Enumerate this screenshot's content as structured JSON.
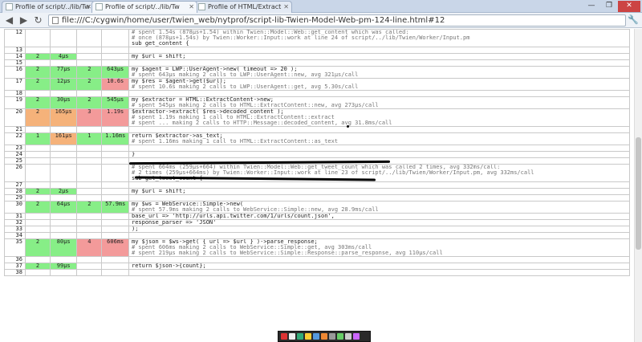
{
  "browser": {
    "tabs": [
      {
        "title": "Profile of script/../lib/Tw"
      },
      {
        "title": "Profile of script/../lib/Tw"
      },
      {
        "title": "Profile of HTML/Extract"
      }
    ],
    "address": "file:///C:/cygwin/home/user/twien_web/nytprof/script-lib-Twien-Model-Web-pm-124-line.html#12"
  },
  "rows": [
    {
      "ln": "12",
      "c1": "",
      "c2": "",
      "c3": "",
      "c4": "",
      "cls": [
        "",
        "",
        "",
        ""
      ],
      "code": [
        "# spent 1.54s (878µs+1.54) within Twien::Model::Web::get_content which was called:",
        "#   once (878µs+1.54s) by Twien::Worker::Input::work at line 24 of script/../lib/Twien/Worker/Input.pm",
        "sub get_content {"
      ]
    },
    {
      "ln": "13",
      "c1": "",
      "c2": "",
      "c3": "",
      "c4": "",
      "cls": [
        "",
        "",
        "",
        ""
      ],
      "code": [
        ""
      ]
    },
    {
      "ln": "14",
      "c1": "2",
      "c2": "4µs",
      "c3": "",
      "c4": "",
      "cls": [
        "g",
        "g",
        "",
        ""
      ],
      "code": [
        "    my $url = shift;"
      ]
    },
    {
      "ln": "15",
      "c1": "",
      "c2": "",
      "c3": "",
      "c4": "",
      "cls": [
        "",
        "",
        "",
        ""
      ],
      "code": [
        ""
      ]
    },
    {
      "ln": "16",
      "c1": "2",
      "c2": "77µs",
      "c3": "2",
      "c4": "643µs",
      "cls": [
        "g",
        "g",
        "g",
        "g"
      ],
      "code": [
        "    my $agent = LWP::UserAgent->new( timeout => 20 );",
        "    # spent   643µs making 2 calls to LWP::UserAgent::new, avg 321µs/call"
      ]
    },
    {
      "ln": "17",
      "c1": "2",
      "c2": "12µs",
      "c3": "2",
      "c4": "10.6s",
      "cls": [
        "g",
        "g",
        "g",
        "r"
      ],
      "code": [
        "    my $res = $agent->get($url);",
        "    # spent  10.6s making 2 calls to LWP::UserAgent::get, avg 5.30s/call"
      ]
    },
    {
      "ln": "18",
      "c1": "",
      "c2": "",
      "c3": "",
      "c4": "",
      "cls": [
        "",
        "",
        "",
        ""
      ],
      "code": [
        ""
      ]
    },
    {
      "ln": "19",
      "c1": "2",
      "c2": "30µs",
      "c3": "2",
      "c4": "545µs",
      "cls": [
        "g",
        "g",
        "g",
        "g"
      ],
      "code": [
        "    my $extractor = HTML::ExtractContent->new;",
        "    # spent   545µs making 2 calls to HTML::ExtractContent::new, avg 273µs/call"
      ]
    },
    {
      "ln": "20",
      "c1": "2",
      "c2": "165µs",
      "c3": "3",
      "c4": "1.19s",
      "cls": [
        "o",
        "o",
        "r",
        "r"
      ],
      "code": [
        "    $extractor->extract( $res->decoded_content );",
        "    # spent  1.19s making 1 call to HTML::ExtractContent::extract",
        "    # spent  ...  making 2 calls to HTTP::Message::decoded_content, avg 31.8ms/call"
      ]
    },
    {
      "ln": "21",
      "c1": "",
      "c2": "",
      "c3": "",
      "c4": "",
      "cls": [
        "",
        "",
        "",
        ""
      ],
      "code": [
        ""
      ]
    },
    {
      "ln": "22",
      "c1": "1",
      "c2": "161µs",
      "c3": "1",
      "c4": "1.16ms",
      "cls": [
        "g",
        "o",
        "g",
        "g"
      ],
      "code": [
        "    return $extractor->as_text;",
        "    # spent  1.16ms making 1 call to HTML::ExtractContent::as_text"
      ]
    },
    {
      "ln": "23",
      "c1": "",
      "c2": "",
      "c3": "",
      "c4": "",
      "cls": [
        "",
        "",
        "",
        ""
      ],
      "code": [
        ""
      ]
    },
    {
      "ln": "24",
      "c1": "",
      "c2": "",
      "c3": "",
      "c4": "",
      "cls": [
        "",
        "",
        "",
        ""
      ],
      "code": [
        "}"
      ]
    },
    {
      "ln": "25",
      "c1": "",
      "c2": "",
      "c3": "",
      "c4": "",
      "cls": [
        "",
        "",
        "",
        ""
      ],
      "code": [
        ""
      ]
    },
    {
      "ln": "26",
      "c1": "",
      "c2": "",
      "c3": "",
      "c4": "",
      "cls": [
        "",
        "",
        "",
        ""
      ],
      "code": [
        "# spent 664ms (259µs+664) within Twien::Model::Web::get_tweet_count which was called 2 times, avg 332ms/call:",
        "# 2 times (259µs+664ms) by Twien::Worker::Input::work at line 23 of script/../lib/Twien/Worker/Input.pm, avg 332ms/call",
        "sub get_tweet_count {"
      ]
    },
    {
      "ln": "27",
      "c1": "",
      "c2": "",
      "c3": "",
      "c4": "",
      "cls": [
        "",
        "",
        "",
        ""
      ],
      "code": [
        ""
      ]
    },
    {
      "ln": "28",
      "c1": "2",
      "c2": "2µs",
      "c3": "",
      "c4": "",
      "cls": [
        "g",
        "g",
        "",
        ""
      ],
      "code": [
        "    my $url = shift;"
      ]
    },
    {
      "ln": "29",
      "c1": "",
      "c2": "",
      "c3": "",
      "c4": "",
      "cls": [
        "",
        "",
        "",
        ""
      ],
      "code": [
        ""
      ]
    },
    {
      "ln": "30",
      "c1": "2",
      "c2": "64µs",
      "c3": "2",
      "c4": "57.9ms",
      "cls": [
        "g",
        "g",
        "g",
        "g"
      ],
      "code": [
        "    my $ws = WebService::Simple->new(",
        "    # spent  57.9ms making 2 calls to WebService::Simple::new, avg 28.9ms/call"
      ]
    },
    {
      "ln": "31",
      "c1": "",
      "c2": "",
      "c3": "",
      "c4": "",
      "cls": [
        "",
        "",
        "",
        ""
      ],
      "code": [
        "        base_url        => 'http://urls.api.twitter.com/1/urls/count.json',"
      ]
    },
    {
      "ln": "32",
      "c1": "",
      "c2": "",
      "c3": "",
      "c4": "",
      "cls": [
        "",
        "",
        "",
        ""
      ],
      "code": [
        "        response_parser => 'JSON'"
      ]
    },
    {
      "ln": "33",
      "c1": "",
      "c2": "",
      "c3": "",
      "c4": "",
      "cls": [
        "",
        "",
        "",
        ""
      ],
      "code": [
        "    );"
      ]
    },
    {
      "ln": "34",
      "c1": "",
      "c2": "",
      "c3": "",
      "c4": "",
      "cls": [
        "",
        "",
        "",
        ""
      ],
      "code": [
        ""
      ]
    },
    {
      "ln": "35",
      "c1": "2",
      "c2": "80µs",
      "c3": "4",
      "c4": "606ms",
      "cls": [
        "g",
        "g",
        "r",
        "r"
      ],
      "code": [
        "    my $json = $ws->get( { url => $url } )->parse_response;",
        "    # spent   606ms making 2 calls to WebService::Simple::get, avg 303ms/call",
        "    # spent   219µs making 2 calls to WebService::Simple::Response::parse_response, avg 110µs/call"
      ]
    },
    {
      "ln": "36",
      "c1": "",
      "c2": "",
      "c3": "",
      "c4": "",
      "cls": [
        "",
        "",
        "",
        ""
      ],
      "code": [
        ""
      ]
    },
    {
      "ln": "37",
      "c1": "2",
      "c2": "99µs",
      "c3": "",
      "c4": "",
      "cls": [
        "g",
        "g",
        "",
        ""
      ],
      "code": [
        "    return $json->{count};"
      ]
    },
    {
      "ln": "38",
      "c1": "",
      "c2": "",
      "c3": "",
      "c4": "",
      "cls": [
        "",
        "",
        "",
        ""
      ],
      "code": [
        ""
      ]
    }
  ]
}
